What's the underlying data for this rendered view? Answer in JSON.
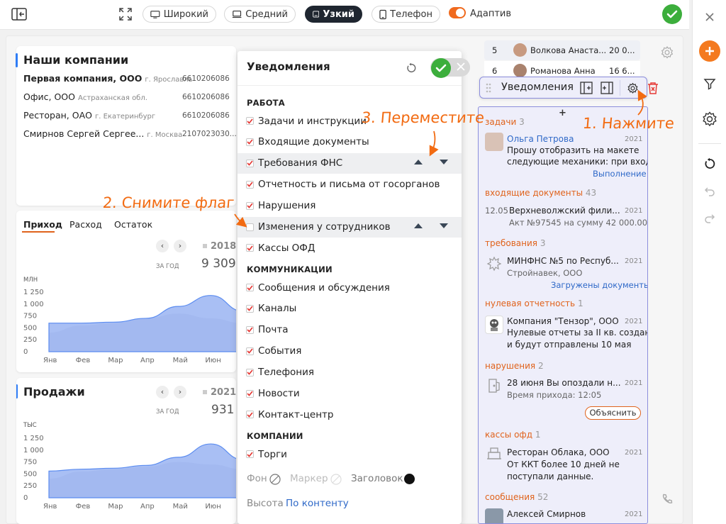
{
  "toolbar": {
    "wide": "Широкий",
    "medium": "Средний",
    "narrow": "Узкий",
    "phone": "Телефон",
    "adaptive": "Адаптив"
  },
  "companies": {
    "title": "Наши компании",
    "rows": [
      {
        "name": "Первая компания, ООО",
        "city": "г. Ярославль",
        "inn": "6610206086"
      },
      {
        "name": "Офис, ООО",
        "city": "Астраханская обл.",
        "inn": "6610206086"
      },
      {
        "name": "Ресторан, ОАО",
        "city": "г. Екатеринбург",
        "inn": "6610206086"
      },
      {
        "name": "Смирнов Сергей Сергее...",
        "city": "г. Москва",
        "inn": "2107023030..."
      }
    ]
  },
  "finance": {
    "tabs": [
      "Приход",
      "Расход",
      "Остаток"
    ],
    "year": "2018",
    "period": "ЗА ГОД",
    "value": "9 309",
    "unit": "МЛН",
    "yticks": [
      "1 250",
      "1 000",
      "750",
      "500",
      "250",
      "0"
    ],
    "months": [
      "Янв",
      "Фев",
      "Мар",
      "Апр",
      "Май",
      "Июн",
      "Июл"
    ]
  },
  "sales": {
    "title": "Продажи",
    "year": "2021",
    "period": "ЗА ГОД",
    "value": "931",
    "unit": "ТЫС",
    "yticks": [
      "1 250",
      "1 000",
      "750",
      "500",
      "250",
      "0"
    ],
    "months": [
      "Янв",
      "Фев",
      "Мар",
      "Апр",
      "Май",
      "Июн",
      "Июл"
    ]
  },
  "chart_data": [
    {
      "type": "area",
      "title": "Приход",
      "ylabel": "МЛН",
      "categories": [
        "Янв",
        "Фев",
        "Мар",
        "Апр",
        "Май",
        "Июн",
        "Июл"
      ],
      "ylim": [
        0,
        1250
      ],
      "series": [
        {
          "values": [
            600,
            600,
            620,
            700,
            950,
            1180,
            850
          ]
        },
        {
          "values": [
            400,
            550,
            600,
            700,
            800,
            700,
            600
          ]
        }
      ]
    },
    {
      "type": "area",
      "title": "Продажи",
      "ylabel": "ТЫС",
      "categories": [
        "Янв",
        "Фев",
        "Мар",
        "Апр",
        "Май",
        "Июн",
        "Июл"
      ],
      "ylim": [
        0,
        1250
      ],
      "series": [
        {
          "values": [
            560,
            600,
            620,
            680,
            850,
            1130,
            800
          ]
        },
        {
          "values": [
            400,
            550,
            600,
            650,
            750,
            700,
            600
          ]
        }
      ]
    }
  ],
  "notif_panel": {
    "title": "Уведомления",
    "sections": [
      {
        "name": "РАБОТА",
        "items": [
          {
            "label": "Задачи и инструкции",
            "checked": true
          },
          {
            "label": "Входящие документы",
            "checked": true
          },
          {
            "label": "Требования ФНС",
            "checked": true
          },
          {
            "label": "Отчетность и письма от госорганов",
            "checked": true
          },
          {
            "label": "Нарушения",
            "checked": true
          },
          {
            "label": "Изменения у сотрудников",
            "checked": false
          },
          {
            "label": "Кассы ОФД",
            "checked": true
          }
        ]
      },
      {
        "name": "КОММУНИКАЦИИ",
        "items": [
          {
            "label": "Сообщения и обсуждения",
            "checked": true
          },
          {
            "label": "Каналы",
            "checked": true
          },
          {
            "label": "Почта",
            "checked": true
          },
          {
            "label": "События",
            "checked": true
          },
          {
            "label": "Телефония",
            "checked": true
          },
          {
            "label": "Новости",
            "checked": true
          },
          {
            "label": "Контакт-центр",
            "checked": true
          }
        ]
      },
      {
        "name": "КОМПАНИИ",
        "items": [
          {
            "label": "Торги",
            "checked": true
          }
        ]
      }
    ],
    "style": {
      "bg": "Фон",
      "marker": "Маркер",
      "header": "Заголовок"
    },
    "height_label": "Высота",
    "height_value": "По контенту"
  },
  "table": {
    "rows": [
      {
        "n": "5",
        "name": "Волкова Анаста...",
        "val": "20 0..."
      },
      {
        "n": "6",
        "name": "Романова Анна",
        "val": "16 6..."
      }
    ]
  },
  "widget_bar": {
    "title": "Уведомления"
  },
  "widget": {
    "s1": {
      "name": "задачи",
      "count": "3"
    },
    "i1": {
      "who": "Ольга Петрова",
      "year": "2021",
      "l1": "Прошу отобразить на макете",
      "l2": "следующие механики: при вход...",
      "link": "Выполнение"
    },
    "s2": {
      "name": "входящие документы",
      "count": "43"
    },
    "i2": {
      "date": "12.05",
      "who": "Верхневолжский фили...",
      "year": "2021",
      "l1": "Акт №97545 на сумму 42 000.00"
    },
    "s3": {
      "name": "требования",
      "count": "3"
    },
    "i3": {
      "who": "МИНФНС №5 по Респуб...",
      "year": "2021",
      "l1": "Стройнавек, ООО",
      "link": "Загружены документы"
    },
    "s4": {
      "name": "нулевая отчетность",
      "count": "1"
    },
    "i4": {
      "who": "Компания \"Тензор\", ООО",
      "year": "2021",
      "l1": "Нулевые отчеты за II кв. созданы",
      "l2": "и будут отправлены 10 мая"
    },
    "s5": {
      "name": "нарушения",
      "count": "2"
    },
    "i5": {
      "who": "28 июня Вы опоздали н...",
      "year": "2021",
      "l1": "Время прихода: 12:05",
      "btn": "Объяснить"
    },
    "s6": {
      "name": "кассы офд",
      "count": "1"
    },
    "i6": {
      "who": "Ресторан Облака, ООО",
      "year": "2021",
      "l1": "От ККТ более 10 дней не",
      "l2": "поступали данные."
    },
    "s7": {
      "name": "сообщения",
      "count": "52"
    },
    "i7": {
      "who": "Алексей Смирнов",
      "year": "2021"
    }
  },
  "annotations": {
    "a1": "1. Нажмите",
    "a2": "2. Снимите флаг",
    "a3": "3. Переместите"
  },
  "colors": {
    "accent": "#f26b12",
    "blue": "#2f7df6",
    "green": "#3cae3c"
  }
}
